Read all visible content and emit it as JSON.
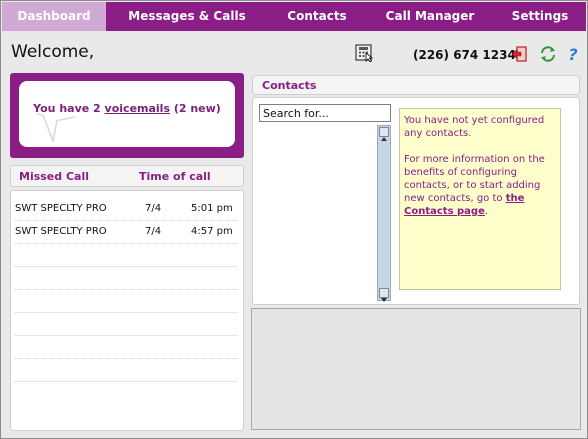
{
  "nav": {
    "tabs": [
      {
        "label": "Dashboard",
        "active": true
      },
      {
        "label": "Messages & Calls",
        "active": false
      },
      {
        "label": "Contacts",
        "active": false
      },
      {
        "label": "Call Manager",
        "active": false
      },
      {
        "label": "Settings",
        "active": false
      }
    ]
  },
  "header": {
    "welcome": "Welcome,",
    "phone_number": "(226) 674 1234",
    "icons": [
      "pager-icon",
      "logout-icon",
      "refresh-icon",
      "help-icon"
    ]
  },
  "voicemail": {
    "prefix": "You have 2 ",
    "link": "voicemails",
    "suffix": " (2 new)"
  },
  "missed_calls": {
    "headers": {
      "caller": "Missed Call",
      "time": "Time of call"
    },
    "rows": [
      {
        "caller": "SWT SPECLTY PRO",
        "date": "7/4",
        "time": "5:01 pm"
      },
      {
        "caller": "SWT SPECLTY PRO",
        "date": "7/4",
        "time": "4:57 pm"
      }
    ]
  },
  "contacts": {
    "title": "Contacts",
    "search_value": "Search for...",
    "info_line1": "You have not yet configured any contacts.",
    "info_line2_prefix": "For more information on the benefits of configuring contacts, or to start adding new contacts, go to ",
    "info_link": "the Contacts page",
    "info_line2_suffix": "."
  },
  "colors": {
    "brand_purple": "#8a1e86",
    "active_tab": "#d0a9d5",
    "info_background": "#ffffcc"
  }
}
